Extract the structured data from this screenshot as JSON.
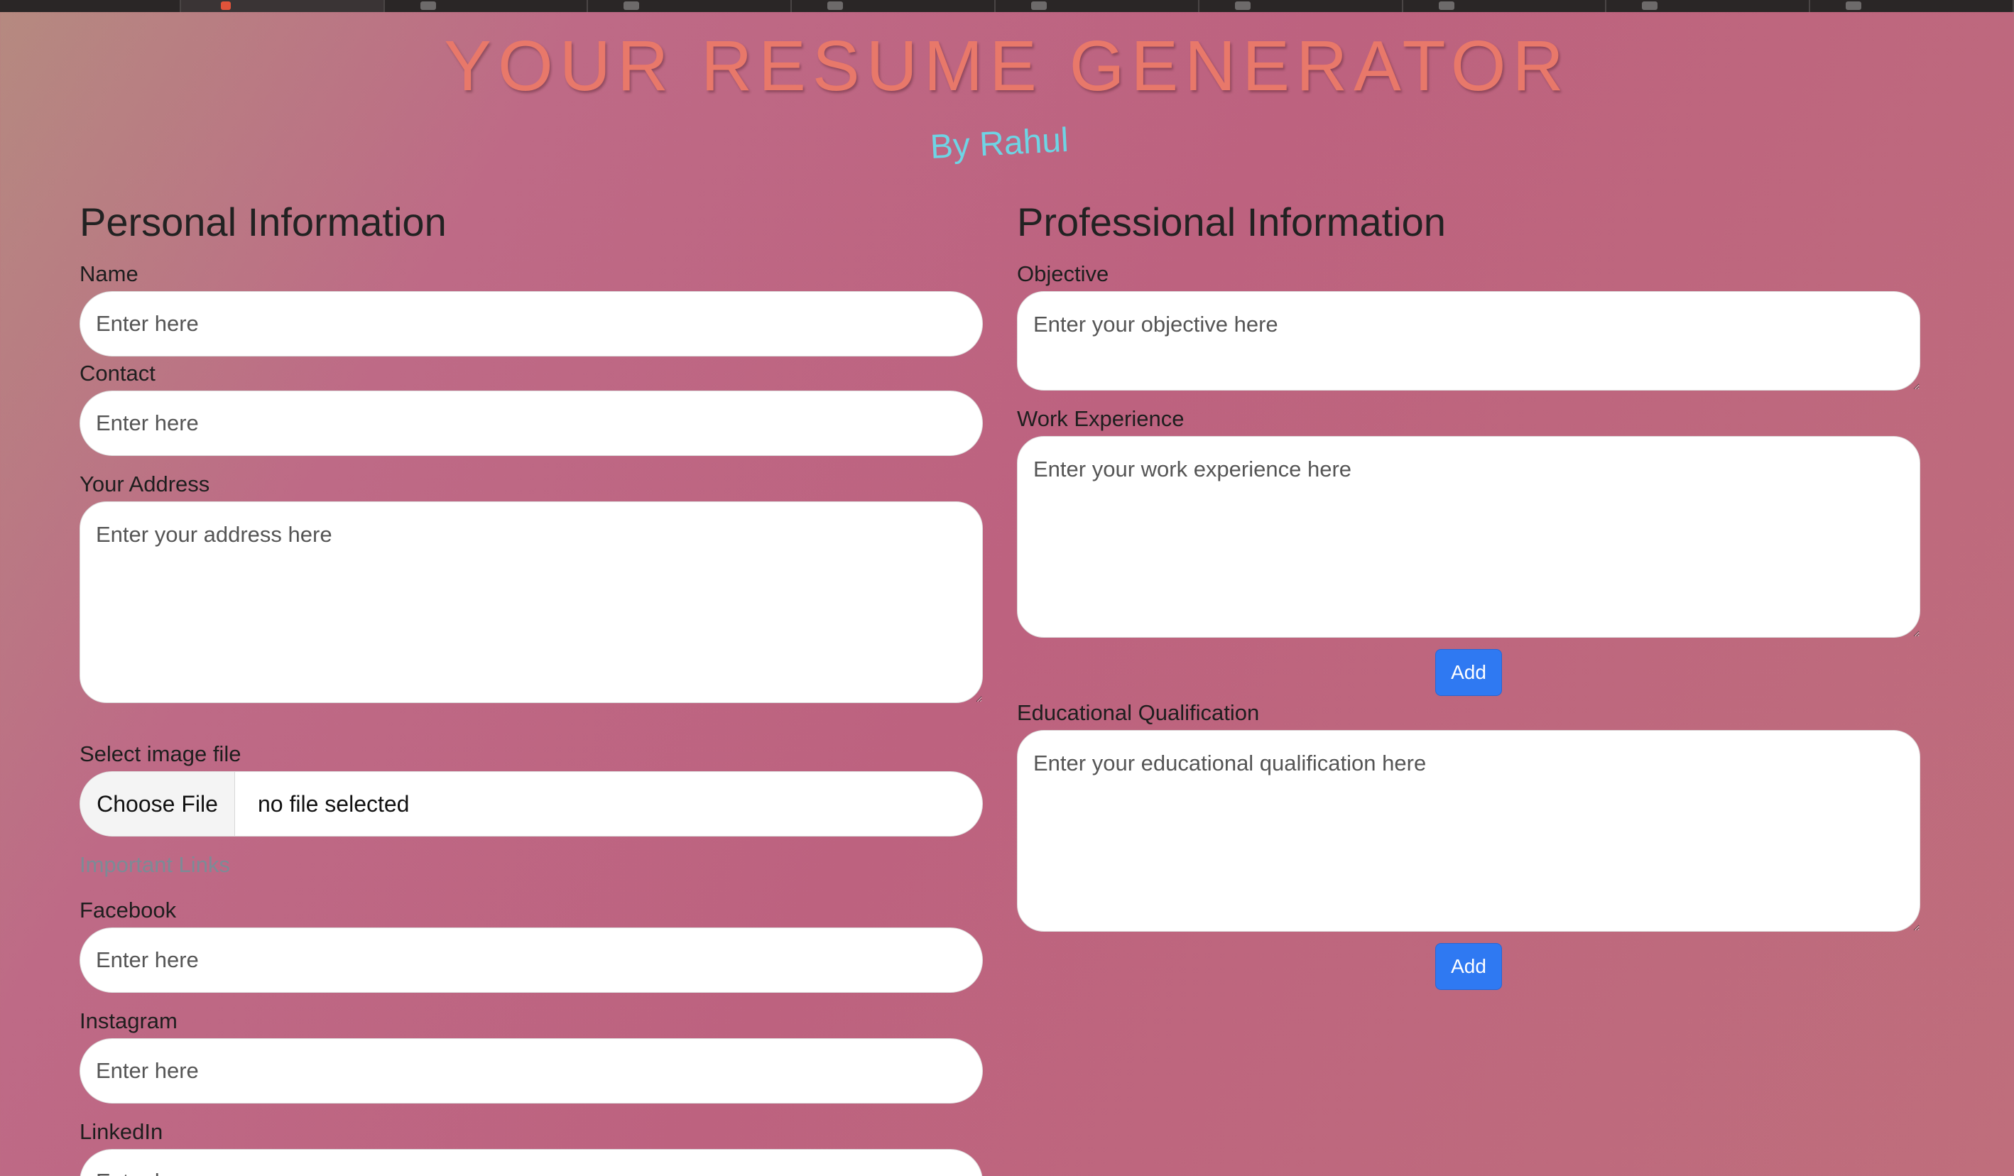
{
  "header": {
    "title": "YOUR RESUME GENERATOR",
    "byline": "By Rahul"
  },
  "personal": {
    "title": "Personal Information",
    "name_label": "Name",
    "name_placeholder": "Enter here",
    "contact_label": "Contact",
    "contact_placeholder": "Enter here",
    "address_label": "Your Address",
    "address_placeholder": "Enter your address here",
    "image_label": "Select image file",
    "choose_file": "Choose File",
    "no_file": "no file selected",
    "links_heading": "Important Links",
    "facebook_label": "Facebook",
    "facebook_placeholder": "Enter here",
    "instagram_label": "Instagram",
    "instagram_placeholder": "Enter here",
    "linkedin_label": "LinkedIn",
    "linkedin_placeholder": "Enter here"
  },
  "professional": {
    "title": "Professional Information",
    "objective_label": "Objective",
    "objective_placeholder": "Enter your objective here",
    "work_label": "Work Experience",
    "work_placeholder": "Enter your work experience here",
    "work_add": "Add",
    "edu_label": "Educational Qualification",
    "edu_placeholder": "Enter your educational qualification here",
    "edu_add": "Add"
  },
  "colors": {
    "title": "#e8786a",
    "byline": "#6ed4e4",
    "button": "#2f79f2"
  }
}
